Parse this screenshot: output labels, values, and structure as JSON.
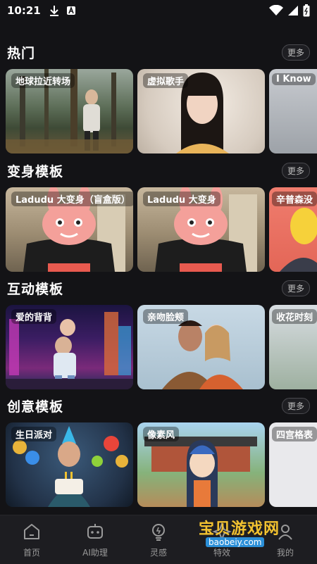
{
  "status_bar": {
    "time": "10:21"
  },
  "sections": [
    {
      "title": "热门",
      "more": "更多",
      "cards": [
        {
          "label": "地球拉近转场"
        },
        {
          "label": "虚拟歌手"
        },
        {
          "label": "I Know"
        }
      ]
    },
    {
      "title": "变身模板",
      "more": "更多",
      "cards": [
        {
          "label": "Ladudu 大变身（盲盒版）"
        },
        {
          "label": "Ladudu 大变身"
        },
        {
          "label": "辛普森没"
        }
      ]
    },
    {
      "title": "互动模板",
      "more": "更多",
      "cards": [
        {
          "label": "爱的背背"
        },
        {
          "label": "亲吻脸颊"
        },
        {
          "label": "收花时刻"
        }
      ]
    },
    {
      "title": "创意模板",
      "more": "更多",
      "cards": [
        {
          "label": "生日派对"
        },
        {
          "label": "像素风"
        },
        {
          "label": "四宫格表"
        }
      ]
    }
  ],
  "bottom_nav": [
    {
      "label": "首页",
      "icon": "home-icon"
    },
    {
      "label": "AI助理",
      "icon": "robot-icon"
    },
    {
      "label": "灵感",
      "icon": "lightbulb-icon"
    },
    {
      "label": "特效",
      "icon": "effects-icon"
    },
    {
      "label": "我的",
      "icon": "profile-icon"
    }
  ],
  "watermark": {
    "text": "宝贝游戏网",
    "url": "baobeiy.com"
  }
}
